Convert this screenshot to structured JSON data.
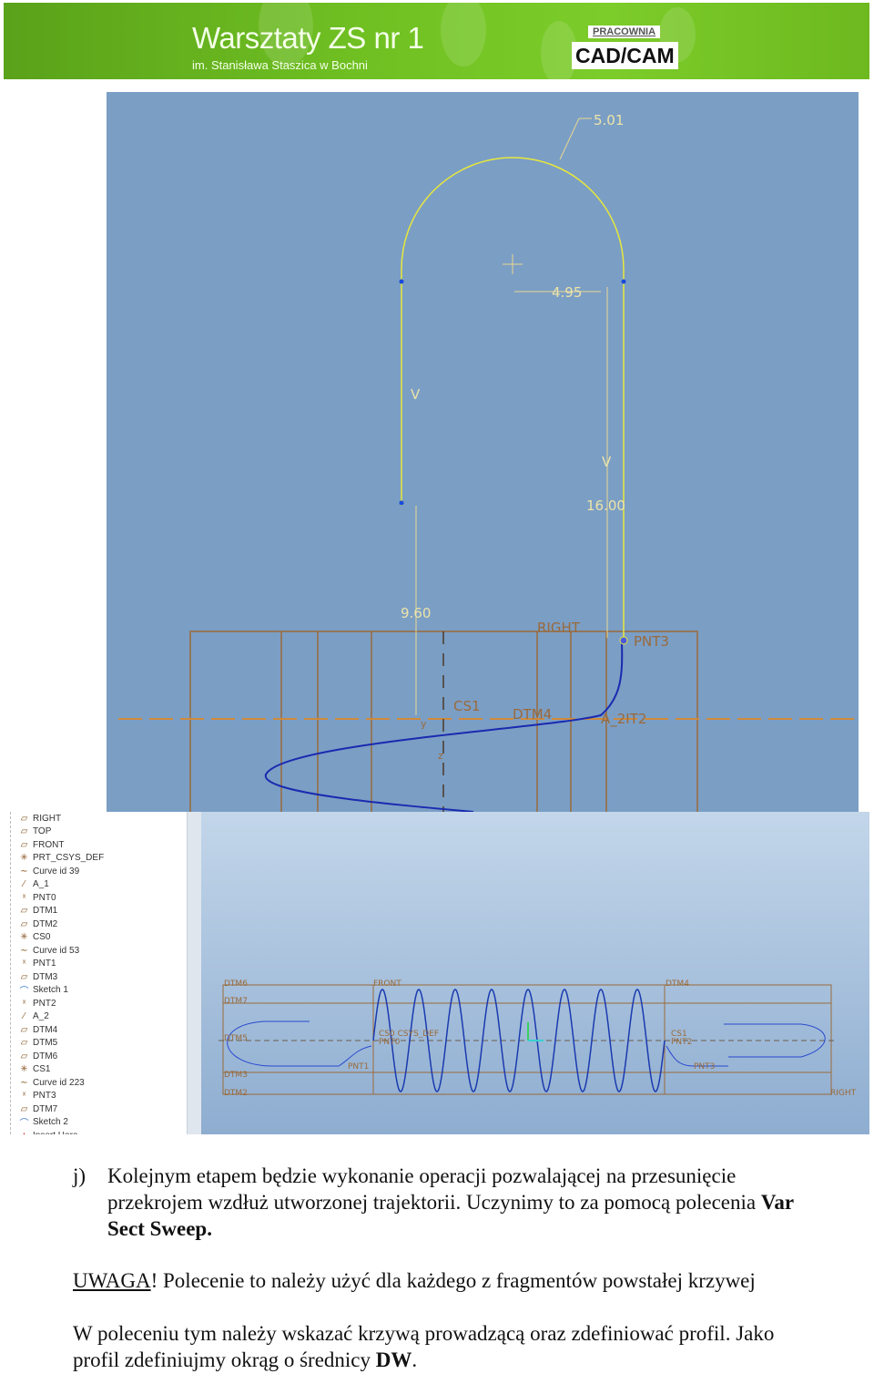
{
  "banner": {
    "title": "Warsztaty ZS nr 1",
    "subtitle": "im. Stanisława Staszica w Bochni",
    "logo_top": "PRACOWNIA",
    "logo_main": "CAD/CAM",
    "color": "#6fbf22"
  },
  "sketch": {
    "dim_radius": "5.01",
    "dim_offset": "4.95",
    "dim_left_v": "V",
    "dim_right_v": "V",
    "dim_height": "16.00",
    "dim_left": "9.60",
    "label_right": "RIGHT",
    "label_pnt3": "PNT3",
    "label_cs1": "CS1",
    "label_dtm4": "DTM4",
    "label_pnt2": "A_2IT2",
    "label_y": "y",
    "label_z": "z",
    "background": "#7b9ec5",
    "curve_color": "#1a2ab0",
    "sketch_color": "#e8e83a",
    "datum_color": "#9a6a3a"
  },
  "model_tree": {
    "items": [
      {
        "icon": "plane-icon",
        "label": "RIGHT"
      },
      {
        "icon": "plane-icon",
        "label": "TOP"
      },
      {
        "icon": "plane-icon",
        "label": "FRONT"
      },
      {
        "icon": "csys-icon",
        "label": "PRT_CSYS_DEF"
      },
      {
        "icon": "curve-icon",
        "label": "Curve id 39"
      },
      {
        "icon": "axis-icon",
        "label": "A_1"
      },
      {
        "icon": "point-icon",
        "label": "PNT0"
      },
      {
        "icon": "plane-icon",
        "label": "DTM1"
      },
      {
        "icon": "plane-icon",
        "label": "DTM2"
      },
      {
        "icon": "csys-icon",
        "label": "CS0"
      },
      {
        "icon": "curve-icon",
        "label": "Curve id 53"
      },
      {
        "icon": "point-icon",
        "label": "PNT1"
      },
      {
        "icon": "plane-icon",
        "label": "DTM3"
      },
      {
        "icon": "sketch-icon",
        "label": "Sketch 1"
      },
      {
        "icon": "point-icon",
        "label": "PNT2"
      },
      {
        "icon": "axis-icon",
        "label": "A_2"
      },
      {
        "icon": "plane-icon",
        "label": "DTM4"
      },
      {
        "icon": "plane-icon",
        "label": "DTM5"
      },
      {
        "icon": "plane-icon",
        "label": "DTM6"
      },
      {
        "icon": "csys-icon",
        "label": "CS1"
      },
      {
        "icon": "curve-icon",
        "label": "Curve id 223"
      },
      {
        "icon": "point-icon",
        "label": "PNT3"
      },
      {
        "icon": "plane-icon",
        "label": "DTM7"
      },
      {
        "icon": "sketch-icon",
        "label": "Sketch 2"
      },
      {
        "icon": "insert-here-icon",
        "label": "Insert Here"
      }
    ]
  },
  "viewport": {
    "labels": {
      "dtm6": "DTM6",
      "dtm7": "DTM7",
      "dtm5": "DTM5",
      "dtm3": "DTM3",
      "dtm2": "DTM2",
      "front": "FRONT",
      "dtm4": "DTM4",
      "right": "RIGHT",
      "cs0": "CS0  CSYS_DEF",
      "pnt0": "PNT0",
      "pnt1": "PNT1",
      "cs1": "CS1",
      "pnt2": "PNT2",
      "pnt3": "PNT3"
    }
  },
  "text": {
    "item_marker": "j)",
    "p1_a": "Kolejnym etapem będzie wykonanie operacji pozwalającej na przesunięcie",
    "p1_b": "przekrojem wzdłuż utworzonej trajektorii. Uczynimy to za pomocą polecenia ",
    "p1_bold_a": "Var",
    "p1_bold_b": "Sect Sweep.",
    "warning_label": "UWAGA",
    "warning_text": "! Polecenie to należy użyć dla każdego z fragmentów powstałej krzywej",
    "p3_a": "W poleceniu tym należy wskazać krzywą prowadzącą oraz zdefiniować profil. Jako",
    "p3_b": "profil zdefiniujmy okrąg o średnicy ",
    "p3_bold": "DW",
    "p3_end": "."
  }
}
